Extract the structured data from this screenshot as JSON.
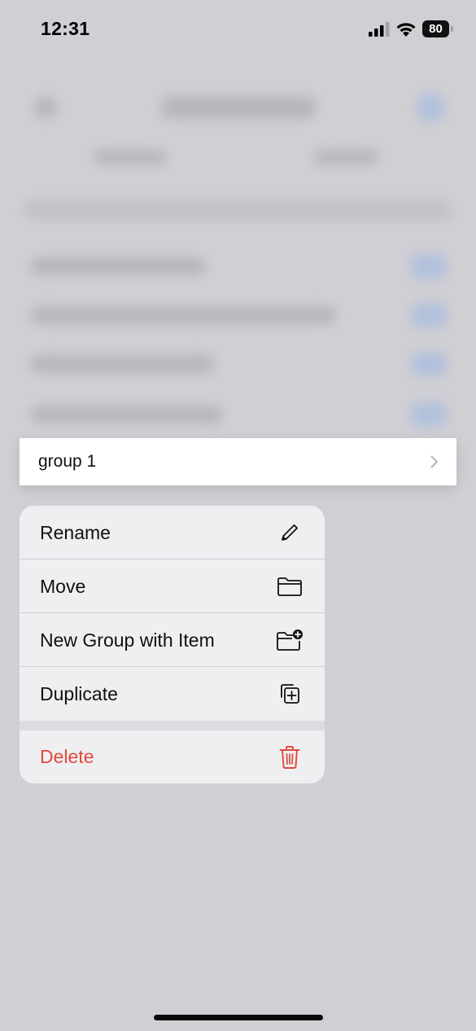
{
  "status_bar": {
    "time": "12:31",
    "battery_level": "80",
    "icons": [
      "signal-icon",
      "wifi-icon",
      "battery-icon"
    ]
  },
  "group_row": {
    "label": "group 1",
    "icon": "chevron-right-icon"
  },
  "context_menu": {
    "items": [
      {
        "label": "Rename",
        "icon": "pencil-icon"
      },
      {
        "label": "Move",
        "icon": "folder-icon"
      },
      {
        "label": "New Group with Item",
        "icon": "folder-plus-icon"
      },
      {
        "label": "Duplicate",
        "icon": "duplicate-icon"
      }
    ],
    "delete": {
      "label": "Delete",
      "icon": "trash-icon",
      "color": "#e0493b"
    }
  }
}
